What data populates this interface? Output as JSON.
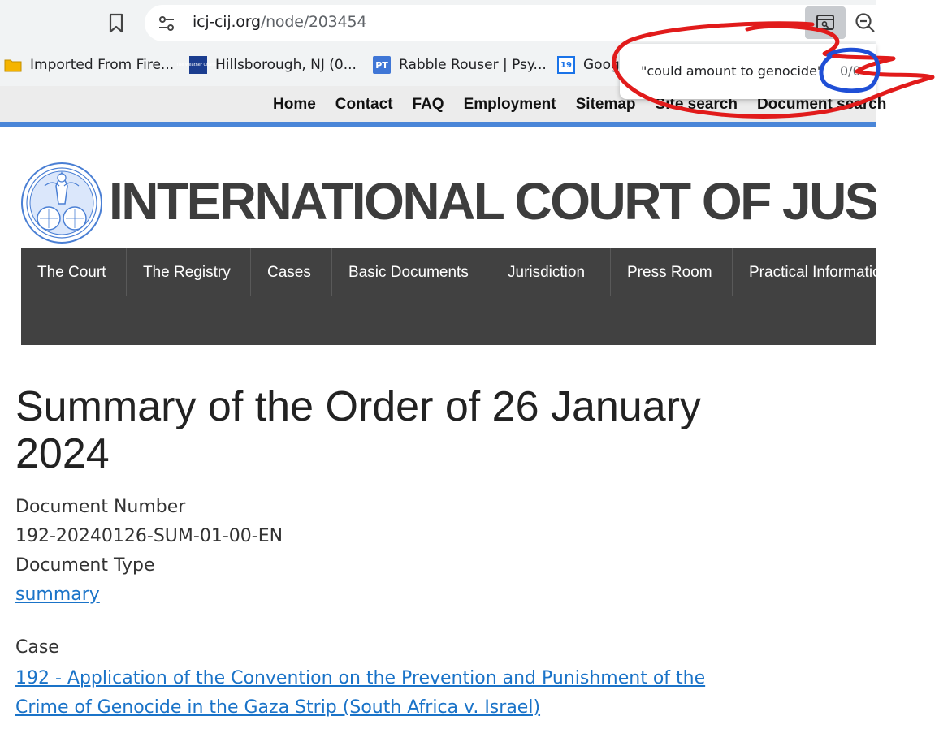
{
  "browser": {
    "url_domain": "icj-cij.org",
    "url_path": "/node/203454",
    "bookmarks": [
      {
        "label": "Imported From Fire...",
        "icon": "folder-icon"
      },
      {
        "label": "Hillsborough, NJ (0...",
        "icon": "weather-channel-icon",
        "icon_text": "The Weather Channel"
      },
      {
        "label": "Rabble Rouser | Psy...",
        "icon": "pt-icon",
        "icon_text": "PT"
      },
      {
        "label": "Goog",
        "icon": "calendar-icon",
        "icon_text": "19"
      }
    ],
    "find": {
      "query": "\"could amount to genocide\"",
      "count": "0/0"
    }
  },
  "site": {
    "top_links": [
      "Home",
      "Contact",
      "FAQ",
      "Employment",
      "Sitemap",
      "Site search",
      "Document search"
    ],
    "title": "INTERNATIONAL COURT OF JUSTICE",
    "nav": [
      "The Court",
      "The Registry",
      "Cases",
      "Basic Documents",
      "Jurisdiction",
      "Press Room",
      "Practical Information"
    ]
  },
  "content": {
    "title": "Summary of the Order of 26 January 2024",
    "doc_number_label": "Document Number",
    "doc_number": "192-20240126-SUM-01-00-EN",
    "doc_type_label": "Document Type",
    "doc_type": "summary",
    "case_label": "Case",
    "case_link": "192 - Application of the Convention on the Prevention and Punishment of the Crime of Genocide in the Gaza Strip (South Africa v. Israel)"
  },
  "colors": {
    "annotation_red": "#e11b1b",
    "annotation_blue": "#1f4fd6",
    "nav_bg": "#414141",
    "link": "#1a73c8"
  }
}
